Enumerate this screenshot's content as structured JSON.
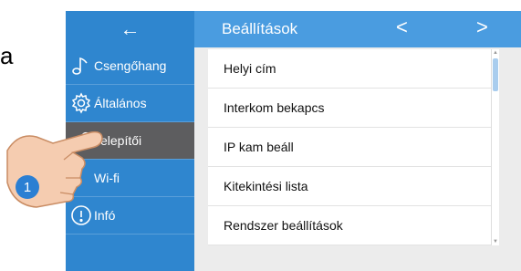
{
  "margin_letter": "a",
  "back_icon": "←",
  "header": {
    "title": "Beállítások",
    "prev": "<",
    "next": ">"
  },
  "sidebar": {
    "items": [
      {
        "label": "Csengőhang",
        "icon": "music-note-icon"
      },
      {
        "label": "Általános",
        "icon": "gear-icon"
      },
      {
        "label": "Telepítői",
        "icon": "wrench-icon"
      },
      {
        "label": "Wi-fi",
        "icon": "wifi-icon"
      },
      {
        "label": "Infó",
        "icon": "info-icon"
      }
    ]
  },
  "list": {
    "rows": [
      "Helyi cím",
      "Interkom bekapcs",
      "IP kam beáll",
      "Kitekintési lista",
      "Rendszer beállítások"
    ]
  },
  "callout_number": "1",
  "colors": {
    "sidebar": "#2f86cf",
    "header": "#4a9ce0",
    "active": "#5d5d5f",
    "callout": "#2b7fd3"
  }
}
